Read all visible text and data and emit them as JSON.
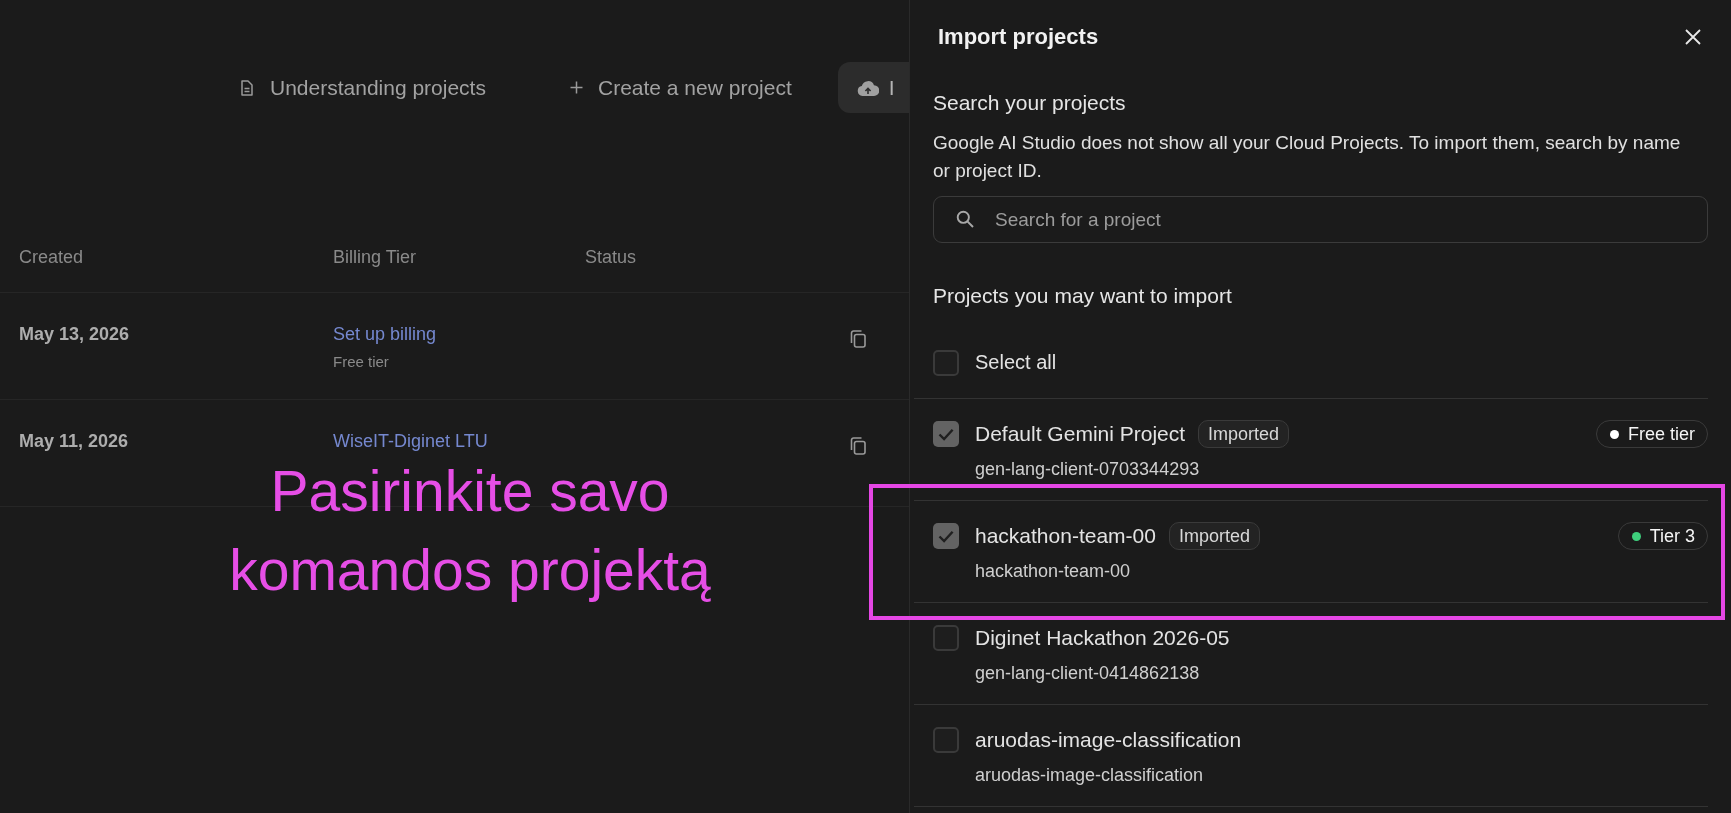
{
  "toolbar": [
    {
      "kind": "docs",
      "label": "Understanding projects"
    },
    {
      "kind": "create",
      "label": "Create a new project"
    },
    {
      "kind": "upload",
      "label": "I"
    }
  ],
  "projects_table": {
    "columns": [
      "Created",
      "Billing Tier",
      "Status"
    ],
    "rows": [
      {
        "created": "May 13, 2026",
        "billing": "Set up billing",
        "billing_note": "Free tier"
      },
      {
        "created": "May 11, 2026",
        "billing": "WiseIT-Diginet LTU"
      }
    ]
  },
  "import_panel": {
    "title": "Import projects",
    "search_section": {
      "heading": "Search your projects",
      "description": "Google AI Studio does not show all your Cloud Projects. To import them, search by name or project ID.",
      "search": {
        "placeholder": "Search for a project"
      }
    },
    "suggestions": {
      "heading": "Projects you may want to import",
      "select_all": {
        "label": "Select all",
        "checked": false
      },
      "projects": [
        {
          "name": "Default Gemini Project",
          "badge": "Imported",
          "tier": {
            "label": "Free tier",
            "color": "#ffffff"
          },
          "id": "gen-lang-client-0703344293",
          "checked": true,
          "highlighted": false
        },
        {
          "name": "hackathon-team-00",
          "badge": "Imported",
          "tier": {
            "label": "Tier 3",
            "color": "#3ecf7c"
          },
          "id": "hackathon-team-00",
          "checked": true,
          "highlighted": true
        },
        {
          "name": "Diginet Hackathon 2026-05",
          "id": "gen-lang-client-0414862138",
          "checked": false,
          "highlighted": false
        },
        {
          "name": "aruodas-image-classification",
          "id": "aruodas-image-classification",
          "checked": false,
          "highlighted": false
        }
      ]
    }
  },
  "annotation": {
    "text": "Pasirinkite savo komandos projektą"
  }
}
